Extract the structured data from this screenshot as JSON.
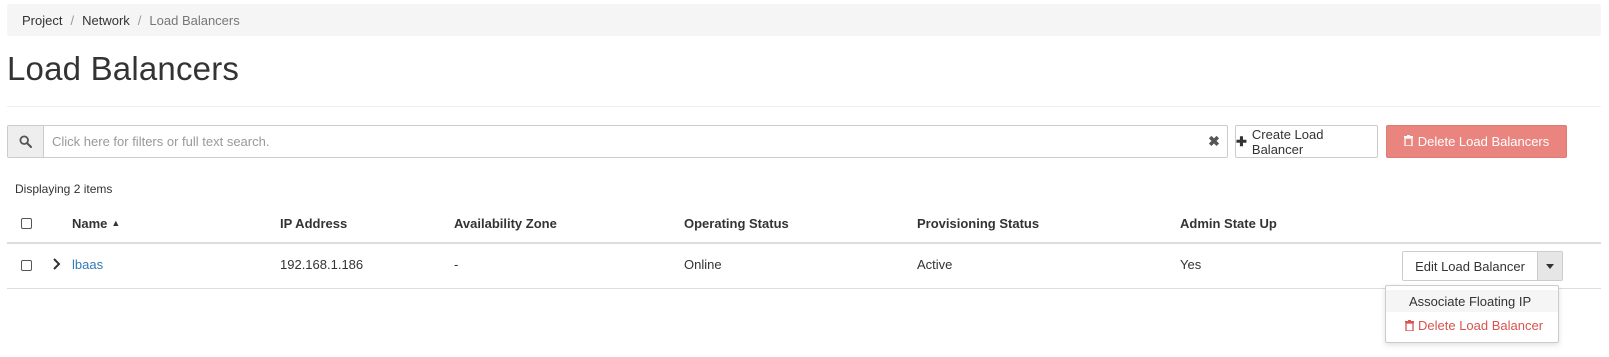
{
  "breadcrumb": {
    "items": [
      "Project",
      "Network"
    ],
    "current": "Load Balancers",
    "separator": "/"
  },
  "page": {
    "title": "Load Balancers"
  },
  "toolbar": {
    "search_placeholder": "Click here for filters or full text search.",
    "search_icon": "search-icon",
    "clear_icon": "close-icon",
    "create_label": "Create Load Balancer",
    "delete_label": "Delete Load Balancers"
  },
  "table": {
    "count_text": "Displaying 2 items",
    "columns": [
      "Name",
      "IP Address",
      "Availability Zone",
      "Operating Status",
      "Provisioning Status",
      "Admin State Up"
    ],
    "sort_column": "Name",
    "rows": [
      {
        "name": "lbaas",
        "ip_address": "192.168.1.186",
        "availability_zone": "-",
        "operating_status": "Online",
        "provisioning_status": "Active",
        "admin_state_up": "Yes",
        "action_label": "Edit Load Balancer"
      }
    ]
  },
  "row_menu": {
    "items": [
      "Associate Floating IP",
      "Delete Load Balancer"
    ]
  },
  "colors": {
    "link": "#337ab7",
    "danger": "#d9534f",
    "danger_button": "#e9847e"
  }
}
